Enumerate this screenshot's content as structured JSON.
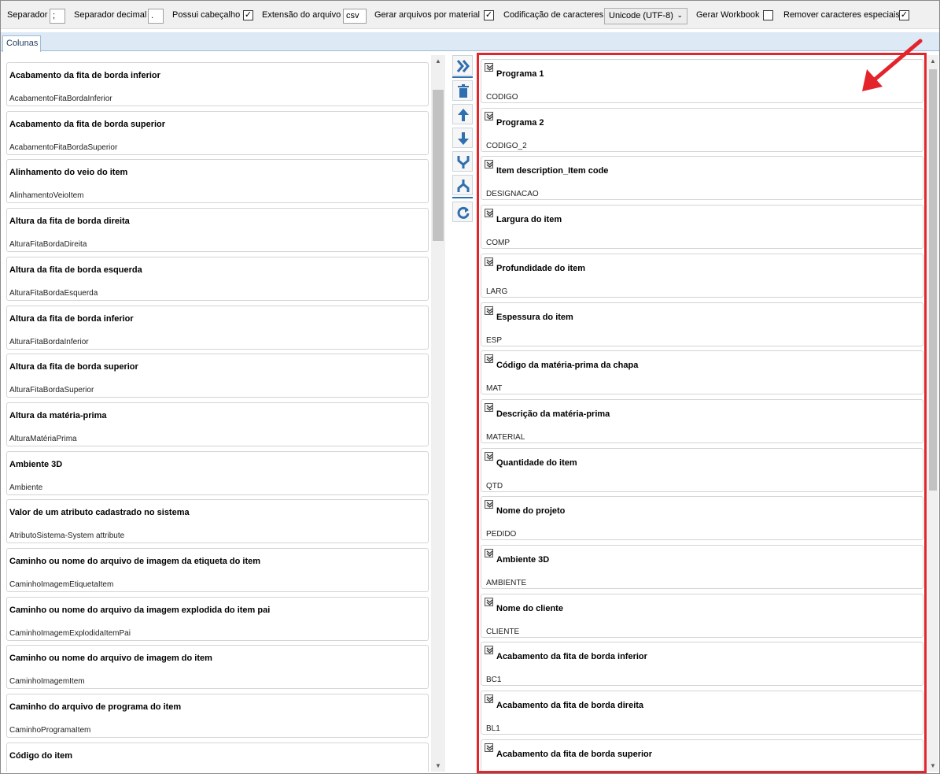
{
  "toolbar": {
    "separator_label": "Separador",
    "separator_value": ";",
    "decimal_label": "Separador decimal",
    "decimal_value": ".",
    "header_label": "Possui cabeçalho",
    "header_checked": "✓",
    "extension_label": "Extensão do arquivo",
    "extension_value": "csv",
    "per_material_label": "Gerar arquivos por material",
    "per_material_checked": "✓",
    "encoding_label": "Codificação de caracteres",
    "encoding_value": "Unicode (UTF-8)",
    "workbook_label": "Gerar Workbook",
    "workbook_checked": "",
    "remove_special_label": "Remover caracteres especiais",
    "remove_special_checked": "✓"
  },
  "tabs": {
    "columns": "Colunas"
  },
  "available_columns": [
    {
      "title": "Acabamento da fita de borda inferior",
      "field": "AcabamentoFitaBordaInferior"
    },
    {
      "title": "Acabamento da fita de borda superior",
      "field": "AcabamentoFitaBordaSuperior"
    },
    {
      "title": "Alinhamento do veio do item",
      "field": "AlinhamentoVeioItem"
    },
    {
      "title": "Altura da fita de borda direita",
      "field": "AlturaFitaBordaDireita"
    },
    {
      "title": "Altura da fita de borda esquerda",
      "field": "AlturaFitaBordaEsquerda"
    },
    {
      "title": "Altura da fita de borda inferior",
      "field": "AlturaFitaBordaInferior"
    },
    {
      "title": "Altura da fita de borda superior",
      "field": "AlturaFitaBordaSuperior"
    },
    {
      "title": "Altura da matéria-prima",
      "field": "AlturaMatériaPrima"
    },
    {
      "title": "Ambiente 3D",
      "field": "Ambiente"
    },
    {
      "title": "Valor de um atributo cadastrado no sistema",
      "field": "AtributoSistema-System attribute"
    },
    {
      "title": "Caminho ou nome do arquivo de imagem da etiqueta do item",
      "field": "CaminhoImagemEtiquetaItem"
    },
    {
      "title": "Caminho ou nome do arquivo da imagem explodida do item pai",
      "field": "CaminhoImagemExplodidaItemPai"
    },
    {
      "title": "Caminho ou nome do arquivo de imagem do item",
      "field": "CaminhoImagemItem"
    },
    {
      "title": "Caminho do arquivo de programa do item",
      "field": "CaminhoProgramaItem"
    },
    {
      "title": "Código do item",
      "field": ""
    }
  ],
  "selected_columns": [
    {
      "title": "Programa 1",
      "field": "CODIGO"
    },
    {
      "title": "Programa 2",
      "field": "CODIGO_2"
    },
    {
      "title": "Item description_Item code",
      "field": "DESIGNACAO"
    },
    {
      "title": "Largura do item",
      "field": "COMP"
    },
    {
      "title": "Profundidade do item",
      "field": "LARG"
    },
    {
      "title": "Espessura do item",
      "field": "ESP"
    },
    {
      "title": "Código da matéria-prima da chapa",
      "field": "MAT"
    },
    {
      "title": "Descrição da matéria-prima",
      "field": "MATERIAL"
    },
    {
      "title": "Quantidade do item",
      "field": "QTD"
    },
    {
      "title": "Nome do projeto",
      "field": "PEDIDO"
    },
    {
      "title": "Ambiente 3D",
      "field": "AMBIENTE"
    },
    {
      "title": "Nome do cliente",
      "field": "CLIENTE"
    },
    {
      "title": "Acabamento da fita de borda inferior",
      "field": "BC1"
    },
    {
      "title": "Acabamento da fita de borda direita",
      "field": "BL1"
    },
    {
      "title": "Acabamento da fita de borda superior",
      "field": ""
    }
  ],
  "tool_icons": [
    "add-all-icon",
    "delete-icon",
    "move-up-icon",
    "move-down-icon",
    "merge-icon",
    "split-icon",
    "refresh-icon"
  ],
  "colors": {
    "accent": "#2f6fb0",
    "highlight_border": "#e3242b",
    "tab_bg": "#dde9f5"
  }
}
